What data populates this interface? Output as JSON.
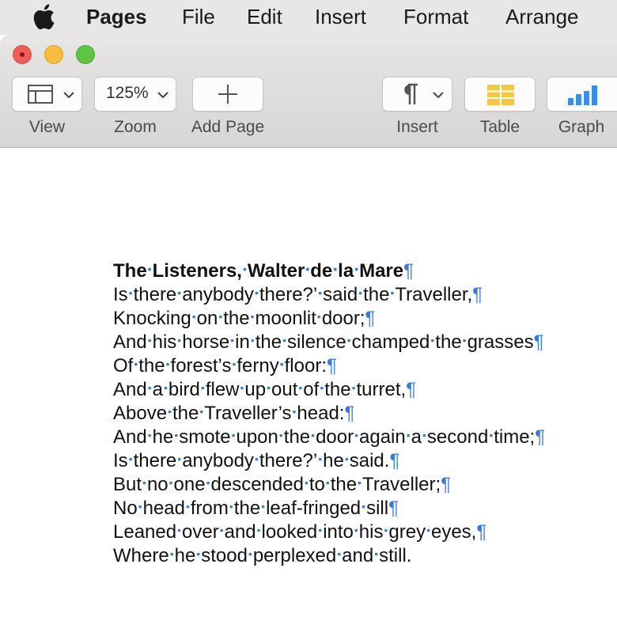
{
  "menubar": {
    "apple_icon": "apple-logo-icon",
    "items": [
      "Pages",
      "File",
      "Edit",
      "Insert",
      "Format",
      "Arrange"
    ]
  },
  "toolbar": {
    "view_label": "View",
    "zoom_value": "125%",
    "zoom_label": "Zoom",
    "add_page_label": "Add Page",
    "insert_label": "Insert",
    "table_label": "Table",
    "graph_label": "Graph"
  },
  "colors": {
    "invisibles": "#3a7bd5",
    "close": "#ed5f56",
    "minimize": "#f5be41",
    "zoom": "#5fc344",
    "table_icon": "#f5c842",
    "graph_icon": "#3a8ee6"
  },
  "document": {
    "lines": [
      "The Listeners, Walter de la Mare",
      "Is there anybody there?’ said the Traveller,",
      "Knocking on the moonlit door;",
      "And his horse in the silence champed the grasses",
      "Of the forest’s ferny floor:",
      "And a bird flew up out of the turret,",
      "Above the Traveller’s head:",
      "And he smote upon the door again a second time;",
      "Is there anybody there?’ he said.",
      "But no one descended to the Traveller;",
      "No head from the leaf-fringed sill",
      "Leaned over and looked into his grey eyes,",
      "Where he stood perplexed and still."
    ],
    "paragraph_mark": "¶",
    "space_mark": "•"
  }
}
